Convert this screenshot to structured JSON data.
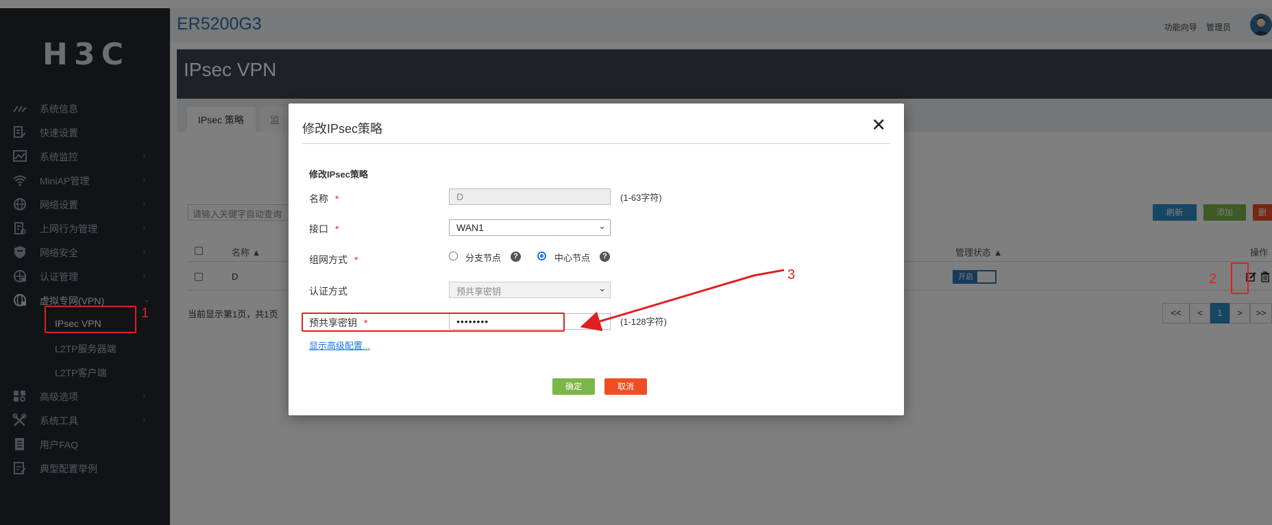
{
  "sidebar": {
    "logo_text": "H3C",
    "items": [
      {
        "label": "系统信息",
        "icon": "gauge-icon",
        "has_chevron": false
      },
      {
        "label": "快速设置",
        "icon": "quick-setup-icon",
        "has_chevron": false
      },
      {
        "label": "系统监控",
        "icon": "monitor-chart-icon",
        "has_chevron": true
      },
      {
        "label": "MiniAP管理",
        "icon": "wifi-icon",
        "has_chevron": true
      },
      {
        "label": "网络设置",
        "icon": "globe-icon",
        "has_chevron": true
      },
      {
        "label": "上网行为管理",
        "icon": "behavior-icon",
        "has_chevron": true
      },
      {
        "label": "网络安全",
        "icon": "shield-icon",
        "has_chevron": true
      },
      {
        "label": "认证管理",
        "icon": "auth-globe-icon",
        "has_chevron": true
      },
      {
        "label": "虚拟专网(VPN)",
        "icon": "vpn-globe-icon",
        "has_chevron": true,
        "expanded": true
      }
    ],
    "sub_items": [
      {
        "label": "IPsec VPN",
        "selected": true
      },
      {
        "label": "L2TP服务器端",
        "selected": false
      },
      {
        "label": "L2TP客户端",
        "selected": false
      }
    ],
    "items_after": [
      {
        "label": "高级选项",
        "icon": "grid-search-icon",
        "has_chevron": true
      },
      {
        "label": "系统工具",
        "icon": "tools-icon",
        "has_chevron": true
      },
      {
        "label": "用户FAQ",
        "icon": "document-icon",
        "has_chevron": false
      },
      {
        "label": "典型配置举例",
        "icon": "config-example-icon",
        "has_chevron": false
      }
    ]
  },
  "topbar": {
    "product": "ER5200G3",
    "links": [
      "功能向导",
      "管理员"
    ]
  },
  "page": {
    "title": "IPsec VPN",
    "tab_active": "IPsec 策略",
    "tab_second": "监",
    "search_placeholder": "请输入关键字自动查询",
    "buttons": {
      "refresh": "刷新",
      "add": "添加",
      "delete": "删"
    },
    "table_headers": {
      "name": "名称",
      "admin_status": "管理状态",
      "actions": "操作"
    },
    "row": {
      "name": "D",
      "status": "开启"
    },
    "status_text": "当前显示第1页，共1页",
    "pager": [
      "<<",
      "<",
      "1",
      ">",
      ">>"
    ]
  },
  "modal": {
    "title": "修改IPsec策略",
    "close_glyph": "✕",
    "section_title": "修改IPsec策略",
    "fields": {
      "name": {
        "label": "名称",
        "value": "D",
        "hint": "(1-63字符)"
      },
      "interface": {
        "label": "接口",
        "value": "WAN1"
      },
      "network_mode": {
        "label": "组网方式",
        "options": [
          "分支节点",
          "中心节点"
        ],
        "selected": "中心节点"
      },
      "auth_method": {
        "label": "认证方式",
        "value": "预共享密钥"
      },
      "psk": {
        "label": "预共享密钥",
        "value": "••••••••",
        "hint": "(1-128字符)"
      }
    },
    "advanced_link": "显示高级配置...",
    "ok": "确定",
    "cancel": "取消"
  },
  "annotations": {
    "n1": "1",
    "n2": "2",
    "n3": "3"
  },
  "colors": {
    "annotation": "#e02020",
    "ok_button": "#7cb548",
    "cancel_button": "#ef4e24",
    "accent": "#2a6fb0"
  }
}
